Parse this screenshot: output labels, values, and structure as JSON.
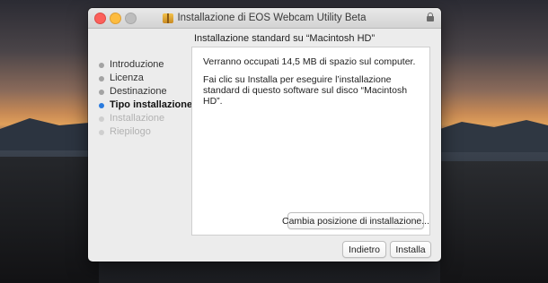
{
  "window": {
    "title": "Installazione di EOS Webcam Utility Beta",
    "subtitle": "Installazione standard su “Macintosh HD”"
  },
  "sidebar": {
    "steps": [
      {
        "label": "Introduzione",
        "state": "done"
      },
      {
        "label": "Licenza",
        "state": "done"
      },
      {
        "label": "Destinazione",
        "state": "done"
      },
      {
        "label": "Tipo installazione",
        "state": "current"
      },
      {
        "label": "Installazione",
        "state": "pending"
      },
      {
        "label": "Riepilogo",
        "state": "pending"
      }
    ]
  },
  "main": {
    "space_text": "Verranno occupati 14,5 MB di spazio sul computer.",
    "instructions": "Fai clic su Installa per eseguire l’installazione standard di questo software sul disco “Macintosh HD”.",
    "change_location_label": "Cambia posizione di installazione..."
  },
  "footer": {
    "back_label": "Indietro",
    "install_label": "Installa"
  },
  "colors": {
    "accent": "#2a7bde",
    "close": "#fc605b",
    "minimize": "#fdbc40"
  },
  "icons": {
    "title_icon": "package-icon",
    "secure": "lock-icon"
  }
}
